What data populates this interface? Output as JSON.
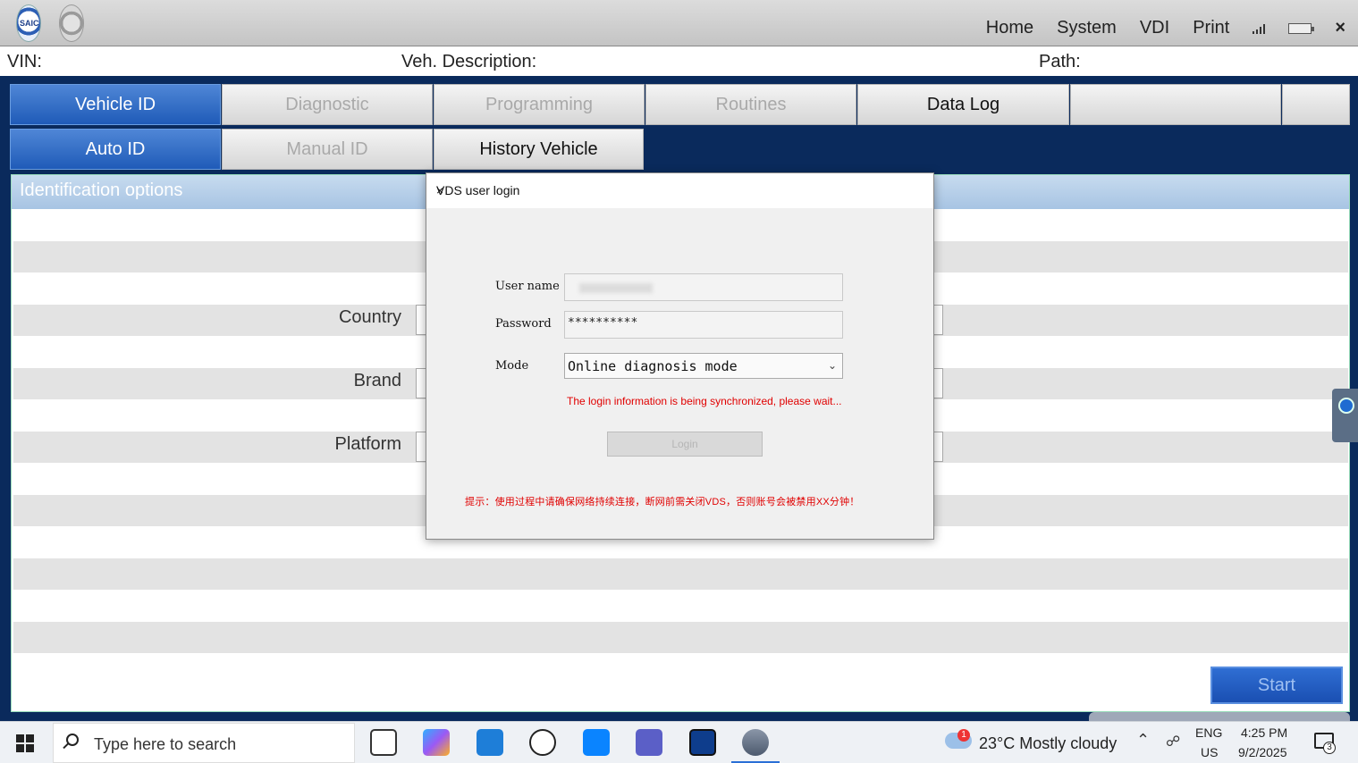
{
  "titlebar": {
    "menu": [
      "Home",
      "System",
      "VDI",
      "Print"
    ],
    "close": "×"
  },
  "infobar": {
    "vin_label": "VIN:",
    "veh_desc_label": "Veh. Description:",
    "path_label": "Path:"
  },
  "tabs_top": [
    "Vehicle ID",
    "Diagnostic",
    "Programming",
    "Routines",
    "Data Log",
    ""
  ],
  "tabs_sub": [
    "Auto ID",
    "Manual ID",
    "History Vehicle"
  ],
  "panel": {
    "header": "Identification options",
    "fields": [
      "Country",
      "Brand",
      "Platform"
    ]
  },
  "start_button": "Start",
  "dialog": {
    "title": "VDS user login",
    "close": "×",
    "user_label": "User name",
    "password_label": "Password",
    "password_value": "**********",
    "mode_label": "Mode",
    "mode_value": "Online diagnosis mode",
    "sync_message": "The login information is being synchronized, please wait...",
    "login_button": "Login",
    "warning": "提示：使用过程中请确保网络持续连接，断网前需关闭VDS，否则账号会被禁用XX分钟！"
  },
  "taskbar": {
    "search_placeholder": "Type here to search",
    "weather_badge": "1",
    "weather": "23°C  Mostly cloudy",
    "lang_top": "ENG",
    "lang_bottom": "US",
    "time": "4:25 PM",
    "date": "9/2/2025",
    "notifications": "3"
  },
  "colors": {
    "background": "#0a2a5c",
    "tab_active": "#1f5bb8",
    "error_text": "#e00000"
  }
}
